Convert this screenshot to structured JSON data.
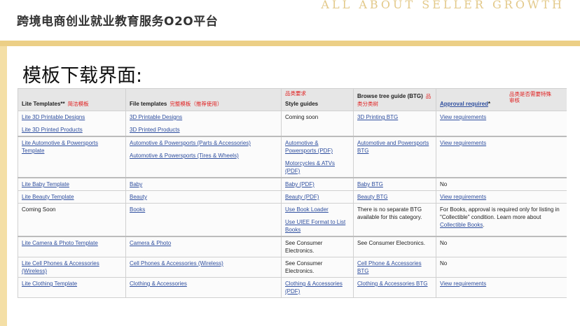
{
  "header": {
    "platform_title": "跨境电商创业就业教育服务O2O平台",
    "slogan": "ALL ABOUT SELLER GROWTH"
  },
  "slide": {
    "title": "模板下载界面:"
  },
  "table": {
    "headers": {
      "lite": "Lite Templates**",
      "lite_note": "简洁模板",
      "file": "File templates",
      "file_note": "完整模板（推荐使用）",
      "style_note": "品类要求",
      "style": "Style guides",
      "btg": "Browse tree guide (BTG)",
      "btg_note": "品类分类树",
      "approval": "Approval required",
      "approval_star": "*",
      "approval_note": "品类是否需要特殊审核"
    },
    "rows": [
      {
        "lite": [
          "Lite 3D Printable Designs",
          "Lite 3D Printed Products"
        ],
        "file": [
          "3D Printable Designs",
          "3D Printed Products"
        ],
        "style": "Coming soon",
        "btg": "3D Printing BTG",
        "approval": "View requirements"
      },
      {
        "lite": [
          "Lite Automotive & Powersports Template"
        ],
        "file": [
          "Automotive & Powersports (Parts & Accessories)",
          "Automotive & Powersports (Tires & Wheels)"
        ],
        "style_links": [
          "Automotive & Powersports (PDF)",
          "Motorcycles & ATVs (PDF)"
        ],
        "btg": "Automotive and Powersports BTG",
        "approval": "View requirements"
      },
      {
        "lite": [
          "Lite Baby Template"
        ],
        "file": [
          "Baby"
        ],
        "style_link": "Baby (PDF)",
        "btg": "Baby BTG",
        "approval": "No"
      },
      {
        "lite": [
          "Lite Beauty Template"
        ],
        "file": [
          "Beauty"
        ],
        "style_link": "Beauty (PDF)",
        "btg": "Beauty BTG",
        "approval": "View requirements"
      },
      {
        "lite_text": "Coming Soon",
        "file": [
          "Books"
        ],
        "style_links": [
          "Use Book Loader",
          "Use UIEE Format to List Books"
        ],
        "btg_text": "There is no separate BTG available for this category.",
        "approval_text": "For Books, approval is required only for listing in \"Collectible\" condition. Learn more about",
        "approval_link": "Collectible Books",
        "approval_end": "."
      },
      {
        "lite": [
          "Lite Camera & Photo Template"
        ],
        "file": [
          "Camera & Photo"
        ],
        "style_text": "See Consumer Electronics.",
        "btg_text": "See Consumer Electronics.",
        "approval": "No"
      },
      {
        "lite": [
          "Lite Cell Phones & Accessories (Wireless)"
        ],
        "file": [
          "Cell Phones & Accessories (Wireless)"
        ],
        "style_text": "See Consumer Electronics.",
        "btg": "Cell Phone & Accessories BTG",
        "approval": "No"
      },
      {
        "lite": [
          "Lite Clothing Template"
        ],
        "file": [
          "Clothing & Accessories"
        ],
        "style_link": "Clothing & Accessories (PDF)",
        "btg": "Clothing & Accessories BTG",
        "approval": "View requirements"
      }
    ]
  }
}
